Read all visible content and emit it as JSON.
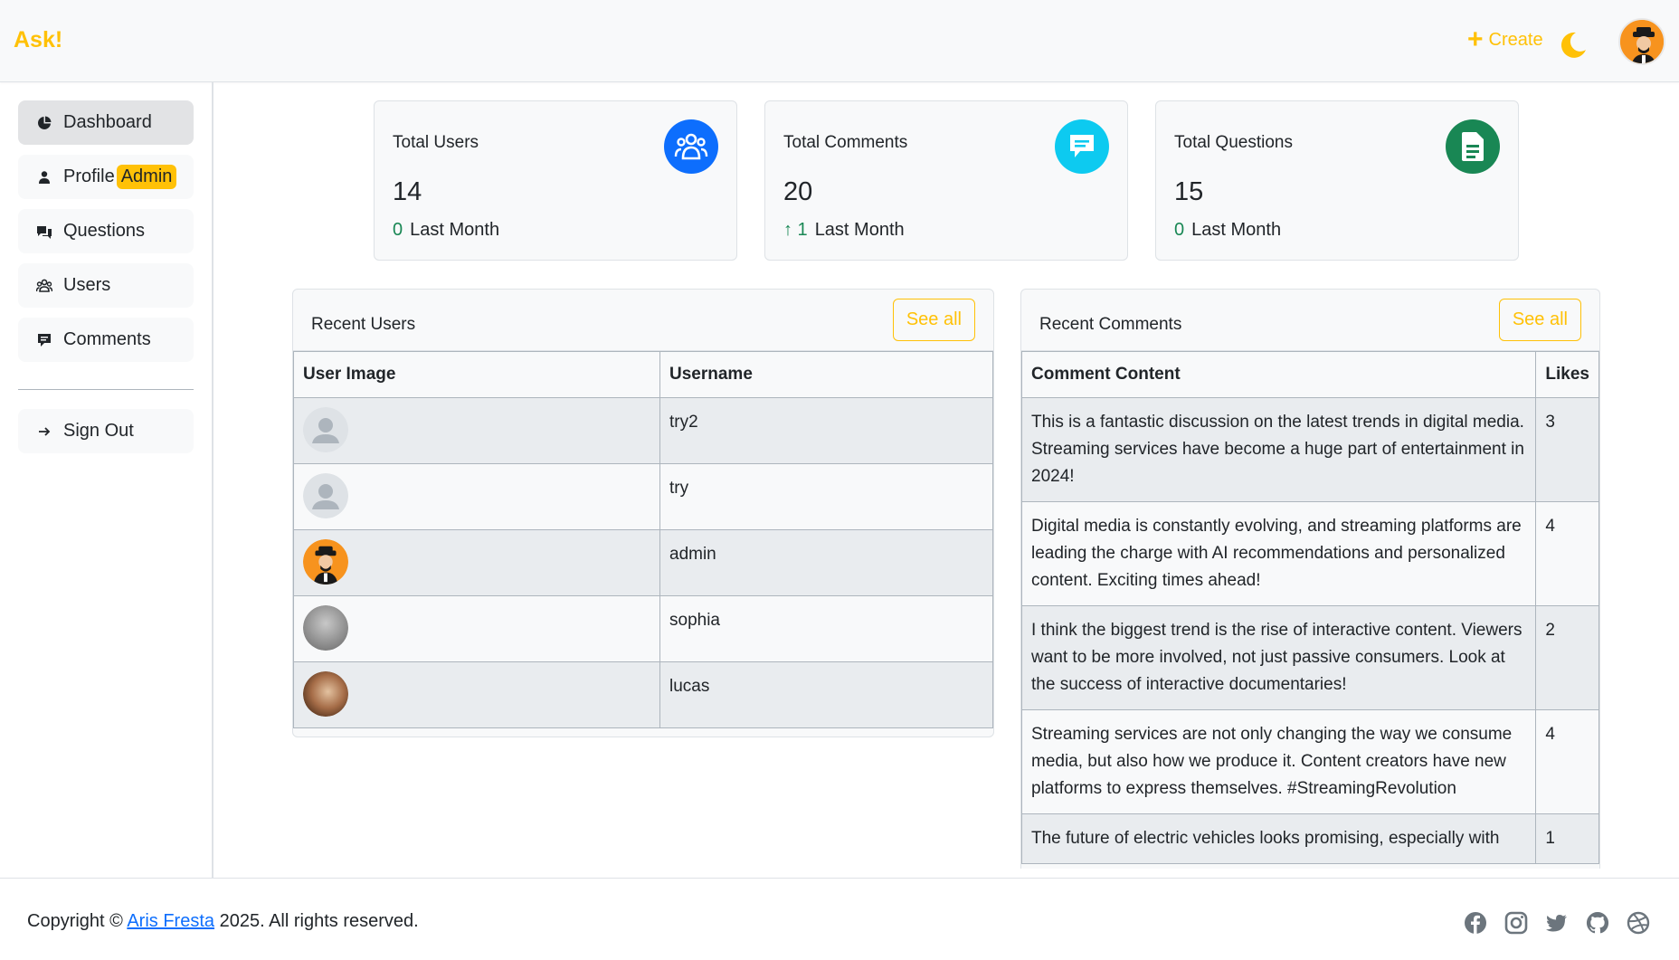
{
  "brand": "Ask!",
  "header": {
    "create_label": "Create"
  },
  "colors": {
    "accent": "#ffc107",
    "primary": "#0d6efd",
    "info": "#0dcaf0",
    "success": "#198754"
  },
  "sidebar": {
    "items": [
      {
        "label": "Dashboard",
        "icon": "pie-chart-icon"
      },
      {
        "label": "Profile",
        "badge": "Admin",
        "icon": "person-icon"
      },
      {
        "label": "Questions",
        "icon": "chat-squares-icon"
      },
      {
        "label": "Users",
        "icon": "people-icon"
      },
      {
        "label": "Comments",
        "icon": "comment-icon"
      }
    ],
    "signout": "Sign Out"
  },
  "stats": [
    {
      "title": "Total Users",
      "value": "14",
      "change": "0",
      "period": "Last Month",
      "icon": "users-icon"
    },
    {
      "title": "Total Comments",
      "value": "20",
      "change": "↑ 1",
      "period": "Last Month",
      "icon": "comment-icon"
    },
    {
      "title": "Total Questions",
      "value": "15",
      "change": "0",
      "period": "Last Month",
      "icon": "document-icon"
    }
  ],
  "recent_users": {
    "title": "Recent Users",
    "see_all": "See all",
    "columns": [
      "User Image",
      "Username"
    ],
    "rows": [
      {
        "username": "try2",
        "avatar": "default"
      },
      {
        "username": "try",
        "avatar": "default"
      },
      {
        "username": "admin",
        "avatar": "admin"
      },
      {
        "username": "sophia",
        "avatar": "photo-gray"
      },
      {
        "username": "lucas",
        "avatar": "photo-brown"
      }
    ]
  },
  "recent_comments": {
    "title": "Recent Comments",
    "see_all": "See all",
    "columns": [
      "Comment Content",
      "Likes"
    ],
    "rows": [
      {
        "content": "This is a fantastic discussion on the latest trends in digital media. Streaming services have become a huge part of entertainment in 2024!",
        "likes": "3"
      },
      {
        "content": "Digital media is constantly evolving, and streaming platforms are leading the charge with AI recommendations and personalized content. Exciting times ahead!",
        "likes": "4"
      },
      {
        "content": "I think the biggest trend is the rise of interactive content. Viewers want to be more involved, not just passive consumers. Look at the success of interactive documentaries!",
        "likes": "2"
      },
      {
        "content": "Streaming services are not only changing the way we consume media, but also how we produce it. Content creators have new platforms to express themselves. #StreamingRevolution",
        "likes": "4"
      },
      {
        "content": "The future of electric vehicles looks promising, especially with",
        "likes": "1"
      }
    ]
  },
  "footer": {
    "prefix": "Copyright ©",
    "author": "Aris Fresta",
    "suffix": "2025. All rights reserved.",
    "socials": [
      "facebook-icon",
      "instagram-icon",
      "twitter-icon",
      "github-icon",
      "dribbble-icon"
    ]
  }
}
